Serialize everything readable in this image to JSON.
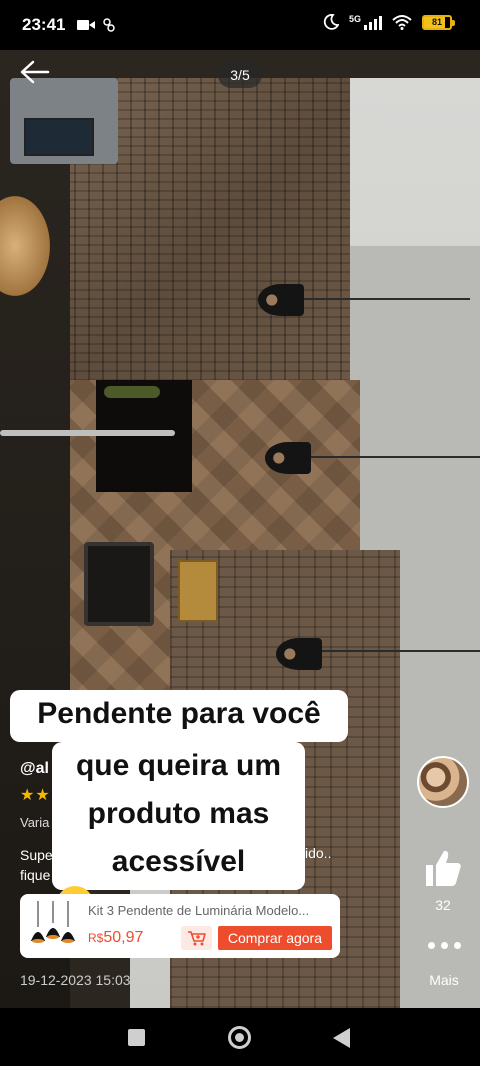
{
  "status_bar": {
    "time": "23:41",
    "network": "5G",
    "battery": "81"
  },
  "viewer": {
    "page_indicator": "3/5"
  },
  "caption": {
    "line1": "Pendente para você",
    "line2": "que queira um",
    "line3": "produto mas",
    "line4": "acessível"
  },
  "review": {
    "author_handle": "@al",
    "stars": "★★",
    "variation_label": "Varia",
    "desc_left_1": "Supe",
    "desc_left_2": "fique",
    "desc_right": "ido..",
    "timestamp": "19-12-2023 15:03"
  },
  "product": {
    "title": "Kit 3 Pendente de Luminária Modelo...",
    "currency": "R$",
    "price": "50,97",
    "buy_label": "Comprar agora"
  },
  "side_actions": {
    "like_count": "32",
    "more_label": "Mais"
  },
  "colors": {
    "accent": "#ee4d2d",
    "star": "#f5b800",
    "battery": "#f2c11a"
  },
  "icons": [
    "video-icon",
    "recording-icon",
    "moon-icon",
    "signal-icon",
    "wifi-icon",
    "battery-icon",
    "back-arrow-icon",
    "thumbs-up-icon",
    "more-dots-icon",
    "cart-icon",
    "kiss-emoji-icon",
    "recent-apps-icon",
    "home-icon",
    "nav-back-icon"
  ]
}
